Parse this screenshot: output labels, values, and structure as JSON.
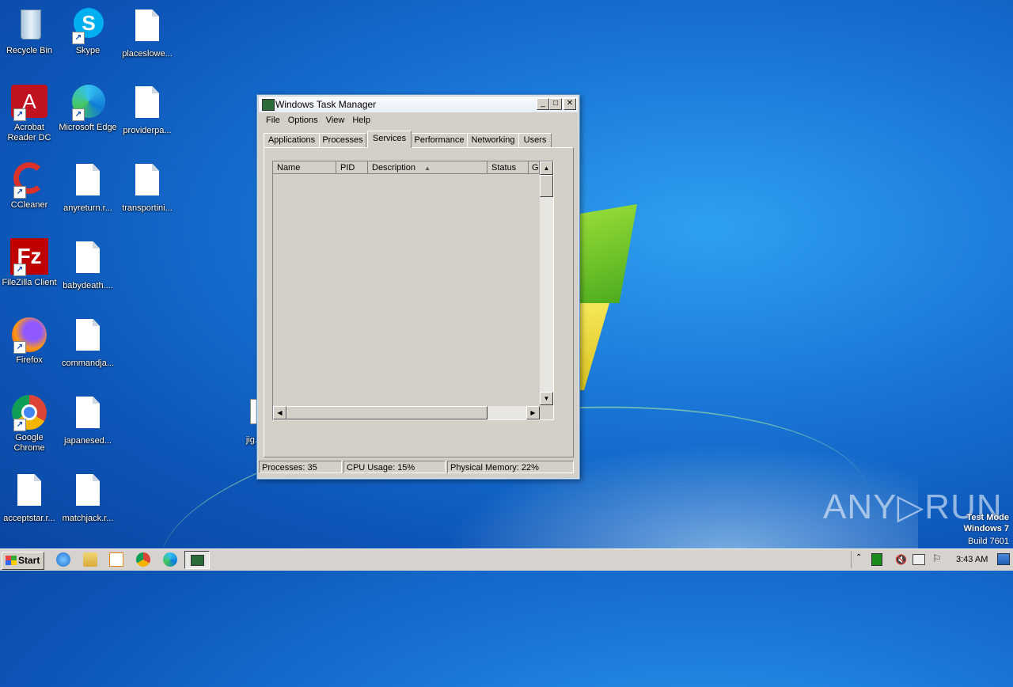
{
  "desktop": {
    "icons": [
      {
        "label": "Recycle Bin"
      },
      {
        "label": "Skype"
      },
      {
        "label": "placeslowe..."
      },
      {
        "label": "Acrobat Reader DC"
      },
      {
        "label": "Microsoft Edge"
      },
      {
        "label": "providerpa..."
      },
      {
        "label": "CCleaner"
      },
      {
        "label": "anyreturn.r..."
      },
      {
        "label": "transportini..."
      },
      {
        "label": "FileZilla Client"
      },
      {
        "label": "babydeath...."
      },
      {
        "label": "Firefox"
      },
      {
        "label": "commandja..."
      },
      {
        "label": "Google Chrome"
      },
      {
        "label": "japanesed..."
      },
      {
        "label": "acceptstar.r..."
      },
      {
        "label": "matchjack.r..."
      },
      {
        "label": "jig..."
      }
    ]
  },
  "window": {
    "title": "Windows Task Manager",
    "menu": [
      "File",
      "Options",
      "View",
      "Help"
    ],
    "tabs": [
      "Applications",
      "Processes",
      "Services",
      "Performance",
      "Networking",
      "Users"
    ],
    "active_tab": "Services",
    "columns": [
      "Name",
      "PID",
      "Description",
      "Status",
      "G"
    ],
    "sort_glyph": "▲",
    "status": {
      "processes": "Processes: 35",
      "cpu": "CPU Usage: 15%",
      "memory": "Physical Memory: 22%"
    }
  },
  "taskbar": {
    "start_label": "Start",
    "clock": "3:43 AM"
  },
  "watermark": {
    "line1": "Test Mode",
    "line2": "Windows 7",
    "line3": "Build 7601",
    "brand": "ANY▷RUN"
  }
}
